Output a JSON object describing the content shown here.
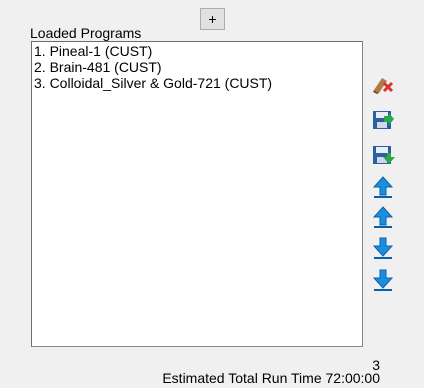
{
  "panel": {
    "title": "Loaded Programs",
    "add_label": "+",
    "programs": [
      "1. Pineal-1 (CUST)",
      "2. Brain-481 (CUST)",
      "3. Colloidal_Silver & Gold-721 (CUST)"
    ],
    "count": "3",
    "runtime_text": "Estimated Total Run Time 72:00:00"
  },
  "toolbar": {
    "icons": [
      "eraser-delete-icon",
      "save-icon",
      "load-icon",
      "move-top-icon",
      "move-up-icon",
      "move-down-icon",
      "move-bottom-icon"
    ]
  },
  "colors": {
    "arrow_blue": "#1a8fe0",
    "save_green": "#2aa84a",
    "delete_red": "#d9342b"
  }
}
